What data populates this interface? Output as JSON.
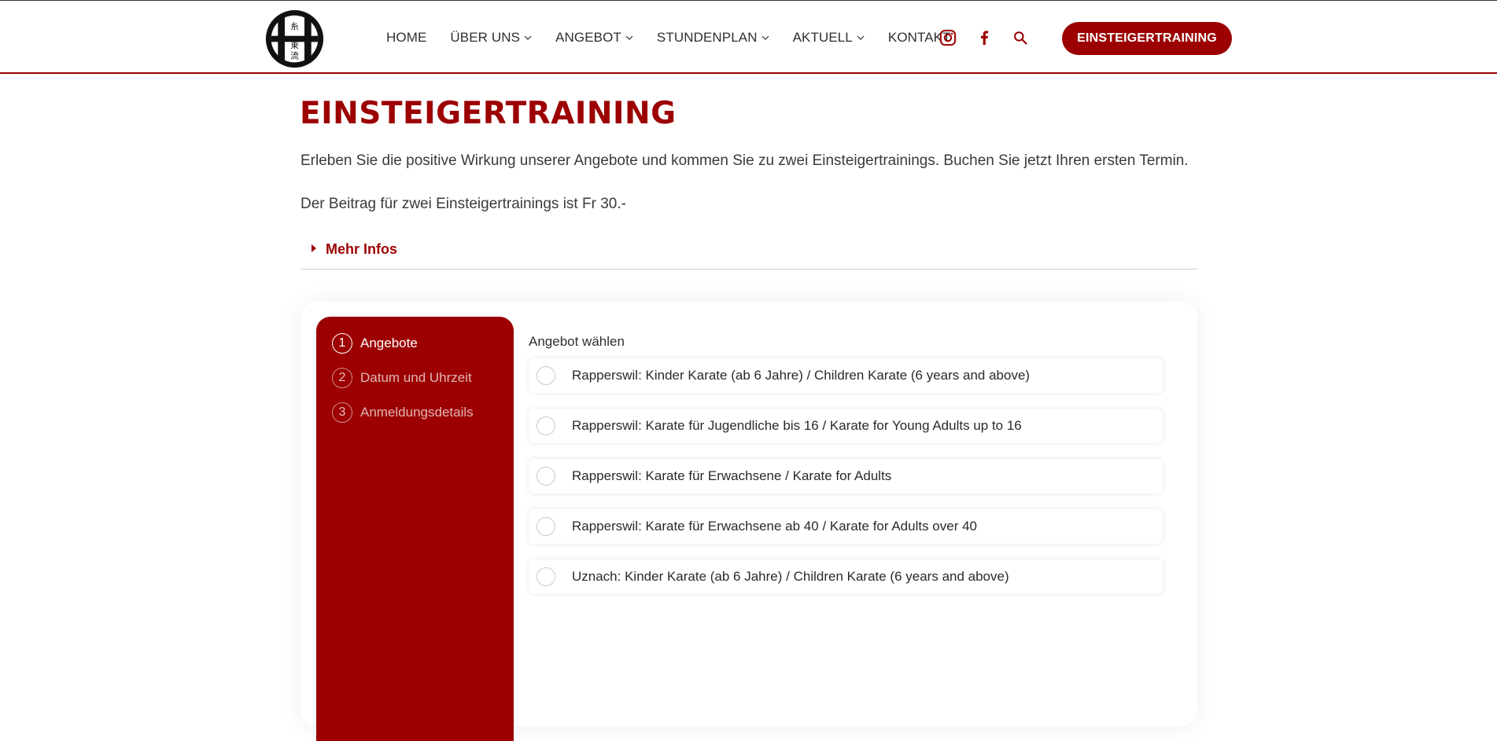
{
  "header": {
    "logo": {
      "glyphs": [
        "糸",
        "東",
        "流"
      ]
    },
    "nav": [
      {
        "label": "HOME",
        "has_dropdown": false
      },
      {
        "label": "ÜBER UNS",
        "has_dropdown": true
      },
      {
        "label": "ANGEBOT",
        "has_dropdown": true
      },
      {
        "label": "STUNDENPLAN",
        "has_dropdown": true
      },
      {
        "label": "AKTUELL",
        "has_dropdown": true
      },
      {
        "label": "KONTAKT",
        "has_dropdown": false
      }
    ],
    "icons": [
      "instagram-icon",
      "facebook-icon",
      "search-icon"
    ],
    "cta_label": "EINSTEIGERTRAINING"
  },
  "main": {
    "title": "EINSTEIGERTRAINING",
    "intro": "Erleben Sie die positive Wirkung unserer Angebote und kommen Sie zu zwei Einsteigertrainings. Buchen Sie jetzt Ihren ersten Termin.",
    "fee": "Der Beitrag für zwei Einsteigertrainings ist Fr 30.-",
    "more_infos": "Mehr Infos"
  },
  "booking": {
    "steps": [
      {
        "number": "1",
        "label": "Angebote",
        "active": true
      },
      {
        "number": "2",
        "label": "Datum und Uhrzeit",
        "active": false
      },
      {
        "number": "3",
        "label": "Anmeldungsdetails",
        "active": false
      }
    ],
    "offers_label": "Angebot wählen",
    "offers": [
      "Rapperswil: Kinder Karate (ab 6 Jahre) / Children Karate (6 years and above)",
      "Rapperswil: Karate für Jugendliche bis 16 / Karate for Young Adults up to 16",
      "Rapperswil: Karate für Erwachsene / Karate for Adults",
      "Rapperswil: Karate für Erwachsene ab 40 / Karate for Adults over 40",
      "Uznach: Kinder Karate (ab 6 Jahre) / Children Karate (6 years and above)"
    ]
  },
  "colors": {
    "brand": "#9c0000",
    "text": "#3a3a3a",
    "nav_text": "#2f2f2f"
  }
}
